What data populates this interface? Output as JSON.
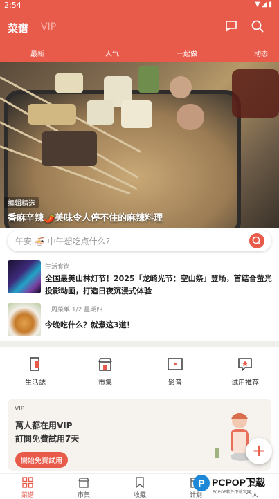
{
  "status_bar": {
    "time": "2:54"
  },
  "app_bar": {
    "title": "菜谱",
    "vip_label": "VIP"
  },
  "tabs": [
    {
      "label": "最新"
    },
    {
      "label": "人气"
    },
    {
      "label": "一起做"
    },
    {
      "label": "动态"
    }
  ],
  "hero": {
    "badge": "编辑精选",
    "caption": "香麻辛辣🌶️美味令人停不住的麻辣料理"
  },
  "search": {
    "placeholder": "午安 🍜 中午想吃点什么?"
  },
  "articles": [
    {
      "category": "生活食尚",
      "title": "全国最美山林灯节！2025「龙崎光节：空山祭」登场，首结合萤光投影动画，打造日夜沉浸式体验"
    },
    {
      "category": "一周菜单 1/2 星期四",
      "title": "今晚吃什么？就煮这3道！"
    }
  ],
  "shortcuts": [
    {
      "label": "生活誌",
      "icon": "magazine-icon"
    },
    {
      "label": "市集",
      "icon": "shop-icon"
    },
    {
      "label": "影音",
      "icon": "video-icon"
    },
    {
      "label": "试用推荐",
      "icon": "trial-star-icon"
    }
  ],
  "vip_card": {
    "tag": "VIP",
    "line1": "萬人都在用VIP",
    "line2": "訂閱免費試用7天",
    "cta": "開始免費試用"
  },
  "fab": {
    "symbol": "+"
  },
  "bottom_nav": [
    {
      "label": "菜谱",
      "icon": "grid-icon"
    },
    {
      "label": "市集",
      "icon": "shop-icon"
    },
    {
      "label": "收藏",
      "icon": "bookmark-icon"
    },
    {
      "label": "计划",
      "icon": "calendar-icon"
    },
    {
      "label": "个人",
      "icon": "person-icon"
    }
  ],
  "watermark": {
    "text": "PCPOP下载",
    "sub": "PCPOP软件下载官网"
  },
  "colors": {
    "accent": "#e85b4b",
    "card_bg": "#f6f3ef"
  }
}
